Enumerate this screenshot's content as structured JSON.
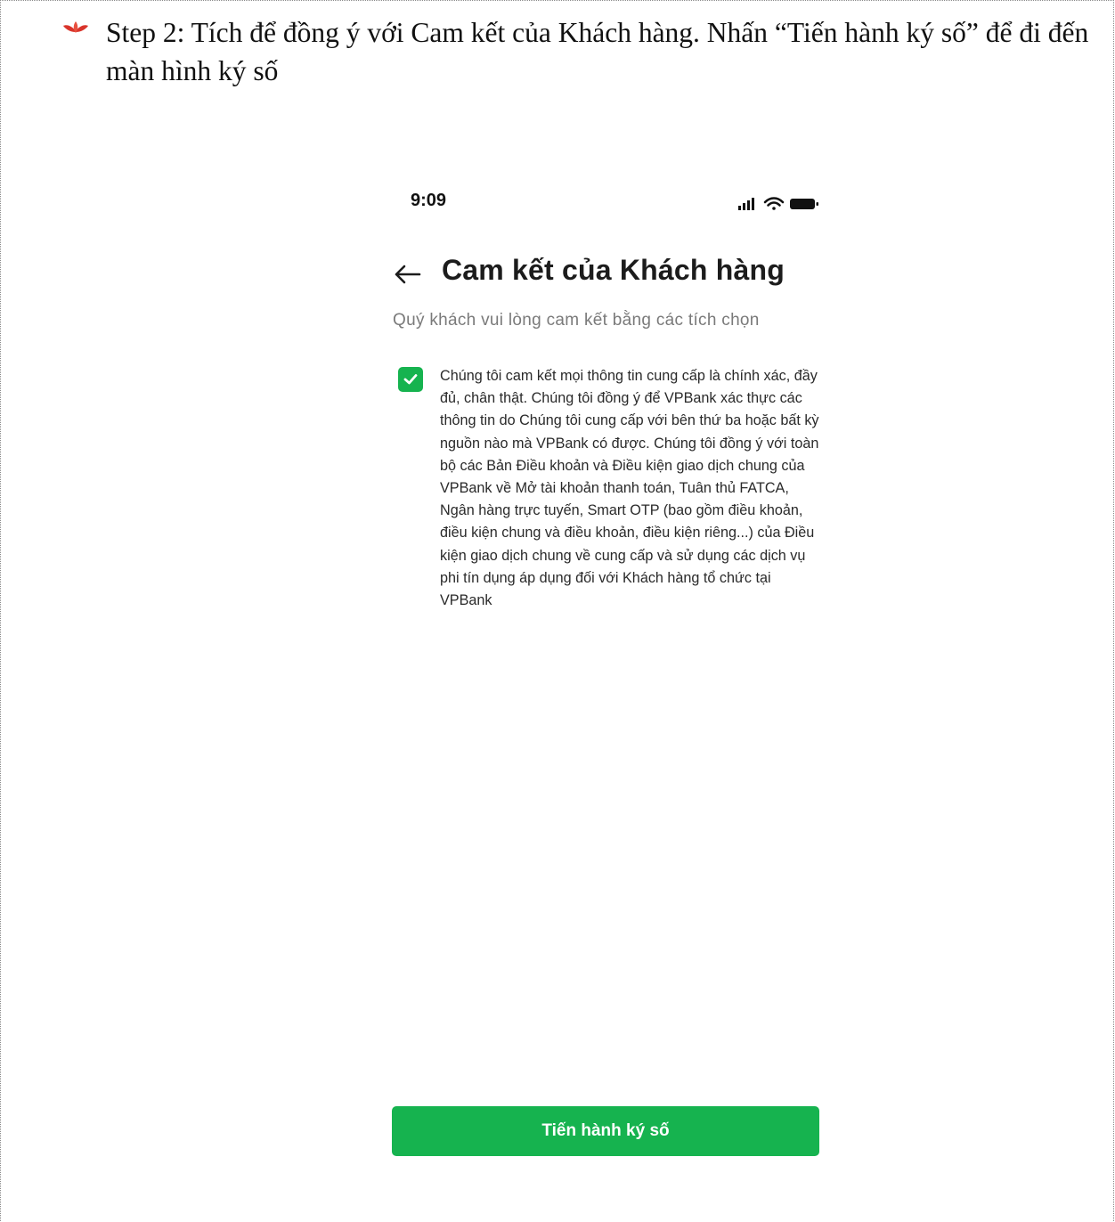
{
  "document": {
    "step_text": "Step 2: Tích để đồng ý với Cam kết của Khách hàng. Nhấn “Tiến hành ký số” để đi đến màn hình ký số"
  },
  "phone": {
    "status_bar": {
      "time": "9:09"
    },
    "header": {
      "title": "Cam kết của Khách hàng"
    },
    "subtitle": "Quý khách vui lòng cam kết bằng các tích chọn",
    "commitment": {
      "checked": true,
      "text": "Chúng tôi cam kết mọi thông tin cung cấp là chính xác, đầy đủ, chân thật. Chúng tôi đồng ý để VPBank xác thực các thông tin do Chúng tôi cung cấp với bên thứ ba hoặc bất kỳ nguồn nào mà VPBank có được. Chúng tôi đồng ý với toàn bộ các Bản Điều khoản và Điều kiện giao dịch chung của VPBank về Mở tài khoản thanh toán, Tuân thủ FATCA, Ngân hàng trực tuyến, Smart OTP (bao gồm điều khoản, điều kiện chung và điều khoản, điều kiện riêng...) của Điều kiện giao dịch chung về cung cấp và sử dụng các dịch vụ phi tín dụng áp dụng đối với Khách hàng tổ chức tại VPBank"
    },
    "cta_label": "Tiến hành ký số"
  },
  "colors": {
    "accent_green": "#16b34f",
    "bullet_red": "#d9342b"
  },
  "icons": [
    "leaf-bullet-icon",
    "signal-icon",
    "wifi-icon",
    "battery-icon",
    "back-arrow-icon",
    "check-icon"
  ]
}
